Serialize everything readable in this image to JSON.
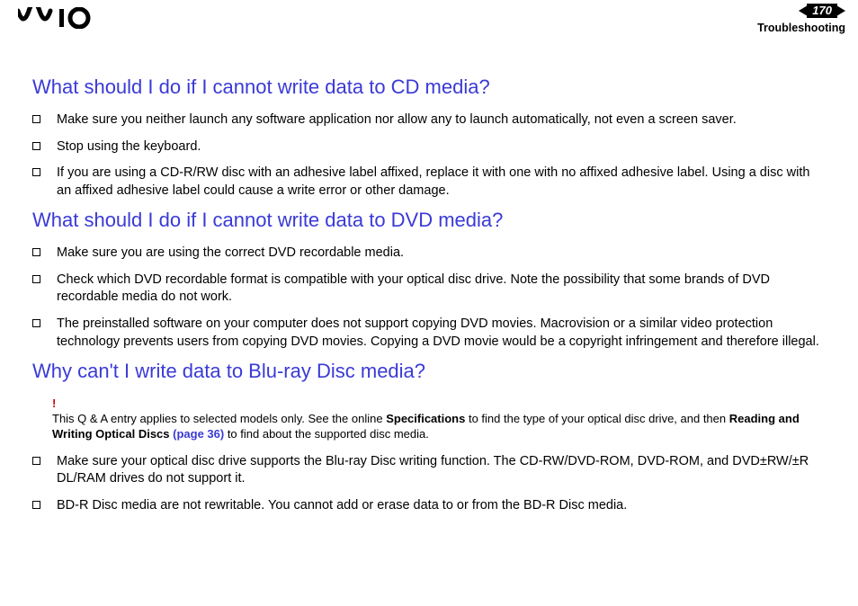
{
  "header": {
    "page_number": "170",
    "section": "Troubleshooting"
  },
  "q1": {
    "title": "What should I do if I cannot write data to CD media?",
    "items": [
      "Make sure you neither launch any software application nor allow any to launch automatically, not even a screen saver.",
      "Stop using the keyboard.",
      "If you are using a CD-R/RW disc with an adhesive label affixed, replace it with one with no affixed adhesive label. Using a disc with an affixed adhesive label could cause a write error or other damage."
    ]
  },
  "q2": {
    "title": "What should I do if I cannot write data to DVD media?",
    "items": [
      "Make sure you are using the correct DVD recordable media.",
      "Check which DVD recordable format is compatible with your optical disc drive. Note the possibility that some brands of DVD recordable media do not work.",
      "The preinstalled software on your computer does not support copying DVD movies. Macrovision or a similar video protection technology prevents users from copying DVD movies. Copying a DVD movie would be a copyright infringement and therefore illegal."
    ]
  },
  "q3": {
    "title": "Why can't I write data to Blu-ray Disc media?",
    "note": {
      "bang": "!",
      "pre": "This Q & A entry applies to selected models only. See the online ",
      "bold1": "Specifications",
      "mid": " to find the type of your optical disc drive, and then ",
      "bold2": "Reading and Writing Optical Discs ",
      "link": "(page 36)",
      "post": " to find about the supported disc media."
    },
    "items": [
      "Make sure your optical disc drive supports the Blu-ray Disc writing function. The CD-RW/DVD-ROM, DVD-ROM, and DVD±RW/±R DL/RAM drives do not support it.",
      "BD-R Disc media are not rewritable. You cannot add or erase data to or from the BD-R Disc media."
    ]
  }
}
